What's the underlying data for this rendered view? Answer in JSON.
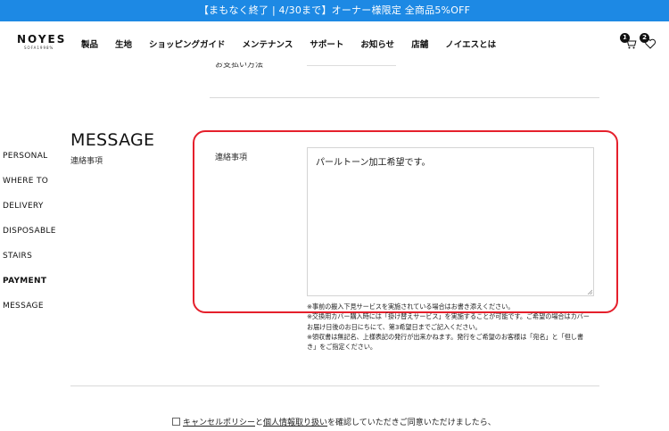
{
  "banner": {
    "text": "【まもなく終了 | 4/30まで】オーナー様限定 全商品5%OFF"
  },
  "header": {
    "logo_main": "NOYES",
    "logo_sub": "SOFA1998%",
    "nav": [
      "製品",
      "生地",
      "ショッピングガイド",
      "メンテナンス",
      "サポート",
      "お知らせ",
      "店舗",
      "ノイエスとは"
    ],
    "cart_count": "1",
    "favorites_count": "2"
  },
  "previous_field": {
    "label": "お支払い方法"
  },
  "side_nav": {
    "items": [
      {
        "label": "PERSONAL",
        "active": false
      },
      {
        "label": "WHERE TO",
        "active": false
      },
      {
        "label": "DELIVERY",
        "active": false
      },
      {
        "label": "DISPOSABLE",
        "active": false
      },
      {
        "label": "STAIRS",
        "active": false
      },
      {
        "label": "PAYMENT",
        "active": true
      },
      {
        "label": "MESSAGE",
        "active": false
      }
    ]
  },
  "section": {
    "title": "MESSAGE",
    "subtitle": "連絡事項"
  },
  "message_field": {
    "label": "連絡事項",
    "value": "パールトーン加工希望です。"
  },
  "notes": [
    "※事前の搬入下見サービスを実施されている場合はお書き添えください。",
    "※交換用カバー購入時には「掛け替えサービス」を実施することが可能です。ご希望の場合はカバー",
    "お届け日後のお日にちにて、第3希望日までご記入ください。",
    "※領収書は無記名、上様表記の発行が出来かねます。発行をご希望のお客様は「宛名」と「但し書",
    "き」をご指定ください。"
  ],
  "consent": {
    "link1": "キャンセルポリシー",
    "conj": "と",
    "link2": "個人情報取り扱い",
    "rest": "を確認していただきご同意いただけましたら、"
  },
  "colors": {
    "banner": "#1d89e4",
    "highlight": "#e5202c"
  }
}
